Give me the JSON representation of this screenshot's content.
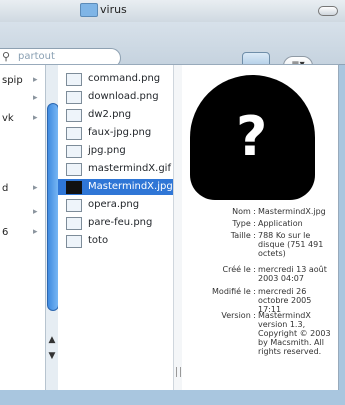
{
  "window": {
    "title": "virus"
  },
  "search": {
    "placeholder": "partout"
  },
  "toolbar": {
    "action_label": "≡▾"
  },
  "sidebar_column": {
    "items": [
      "spip",
      "vk",
      "d",
      "6"
    ]
  },
  "file_column": {
    "files": [
      {
        "name": "command.png",
        "selected": false
      },
      {
        "name": "download.png",
        "selected": false
      },
      {
        "name": "dw2.png",
        "selected": false
      },
      {
        "name": "faux-jpg.png",
        "selected": false
      },
      {
        "name": "jpg.png",
        "selected": false
      },
      {
        "name": "mastermindX.gif",
        "selected": false
      },
      {
        "name": "MastermindX.jpg",
        "selected": true
      },
      {
        "name": "opera.png",
        "selected": false
      },
      {
        "name": "pare-feu.png",
        "selected": false
      },
      {
        "name": "toto",
        "selected": false
      }
    ]
  },
  "preview": {
    "metadata": [
      {
        "key": "Nom :",
        "value": "MastermindX.jpg"
      },
      {
        "key": "Type :",
        "value": "Application"
      },
      {
        "key": "Taille :",
        "value": "788 Ko sur le disque (751 491 octets)"
      },
      {
        "key": "Créé le :",
        "value": "mercredi 13 août 2003 04:07"
      },
      {
        "key": "Modifié le :",
        "value": "mercredi 26 octobre 2005 17:11"
      },
      {
        "key": "Version :",
        "value": "MastermindX version 1.3, Copyright © 2003 by Macsmith. All rights reserved."
      }
    ]
  },
  "icons": {
    "search": "magnifier-icon",
    "folder": "folder-icon",
    "window_toggle": "toolbar-toggle-icon"
  }
}
